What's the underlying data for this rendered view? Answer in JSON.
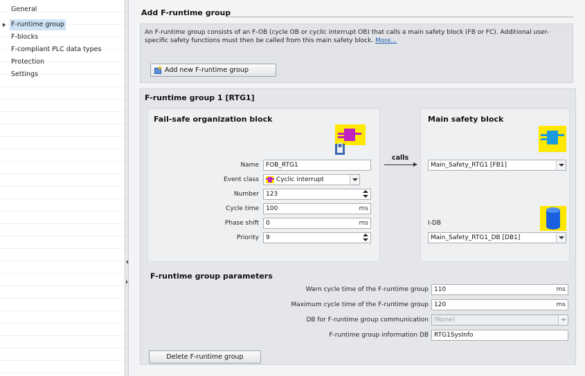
{
  "nav": {
    "items": [
      {
        "label": "General"
      },
      {
        "label": "F-runtime group"
      },
      {
        "label": "F-blocks"
      },
      {
        "label": "F-compliant PLC data types"
      },
      {
        "label": "Protection"
      },
      {
        "label": "Settings"
      }
    ],
    "selected_index": 1
  },
  "add_section": {
    "title": "Add F-runtime group",
    "description": "An F-runtime group consists of an F-OB (cycle OB or cyclic interrupt OB) that calls a main safety block (FB or FC). Additional user-specific safety functions must then be called from this main safety block.",
    "more_link": "More...",
    "add_button_label": "Add new F-runtime group"
  },
  "group": {
    "title": "F-runtime group 1 [RTG1]",
    "fob": {
      "title": "Fail-safe organization block",
      "name_label": "Name",
      "name_value": "FOB_RTG1",
      "event_class_label": "Event class",
      "event_class_value": "Cyclic interrupt",
      "number_label": "Number",
      "number_value": "123",
      "cycle_time_label": "Cycle time",
      "cycle_time_value": "100",
      "cycle_time_unit": "ms",
      "phase_shift_label": "Phase shift",
      "phase_shift_value": "0",
      "phase_shift_unit": "ms",
      "priority_label": "Priority",
      "priority_value": "9"
    },
    "calls_label": "calls",
    "main_block": {
      "title": "Main safety block",
      "value": "Main_Safety_RTG1 [FB1]",
      "idb_label": "I-DB",
      "idb_value": "Main_Safety_RTG1_DB [DB1]"
    },
    "params": {
      "title": "F-runtime group parameters",
      "rows": [
        {
          "label": "Warn cycle time of the F-runtime group",
          "value": "110",
          "unit": "ms"
        },
        {
          "label": "Maximum cycle time of the F-runtime group",
          "value": "120",
          "unit": "ms"
        },
        {
          "label": "DB for F-runtime group communication",
          "value": "(None)",
          "unit": ""
        },
        {
          "label": "F-runtime group information DB",
          "value": "RTG1SysInfo",
          "unit": ""
        }
      ]
    },
    "delete_button_label": "Delete F-runtime group"
  },
  "colors": {
    "ob_icon_bg": "#ffe800",
    "ob_icon_fg": "#c020c0",
    "fb_icon_fg": "#1a9be0",
    "db_icon": "#1a5fe0",
    "selection": "#cfe3f6"
  },
  "icons": [
    "f-runtime-add-icon",
    "fob-lock-icon",
    "main-safety-fb-icon",
    "idb-icon",
    "cyclic-interrupt-icon",
    "nav-expand-arrow-icon"
  ]
}
